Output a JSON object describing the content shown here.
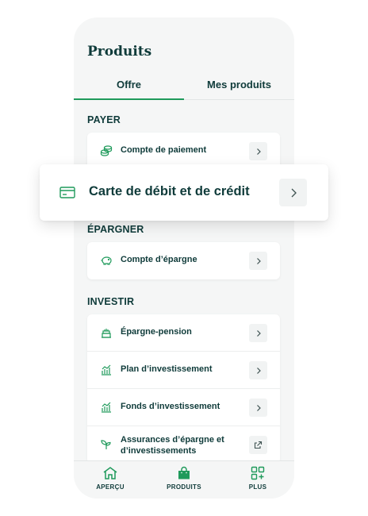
{
  "page": {
    "title": "Produits",
    "tabs": [
      {
        "label": "Offre",
        "active": true
      },
      {
        "label": "Mes produits",
        "active": false
      }
    ]
  },
  "sections": {
    "payer": {
      "heading": "PAYER",
      "items": [
        {
          "label": "Compte de paiement",
          "icon": "coins-icon"
        }
      ]
    },
    "epargner": {
      "heading": "ÉPARGNER",
      "items": [
        {
          "label": "Compte d’épargne",
          "icon": "piggy-bank-icon"
        }
      ]
    },
    "investir": {
      "heading": "INVESTIR",
      "items": [
        {
          "label": "Épargne-pension",
          "icon": "cake-icon",
          "action": "chevron-right-icon"
        },
        {
          "label": "Plan d’investissement",
          "icon": "growth-chart-icon",
          "action": "chevron-right-icon"
        },
        {
          "label": "Fonds d’investissement",
          "icon": "growth-chart-icon",
          "action": "chevron-right-icon"
        },
        {
          "label": "Assurances d’épargne et d’investissements",
          "icon": "sprout-icon",
          "action": "external-link-icon"
        }
      ]
    }
  },
  "popup": {
    "label": "Carte de débit et de crédit",
    "icon": "credit-card-icon"
  },
  "bottom_nav": [
    {
      "label": "APERÇU",
      "icon": "home-icon"
    },
    {
      "label": "PRODUITS",
      "icon": "shopping-bag-icon",
      "active": true
    },
    {
      "label": "PLUS",
      "icon": "grid-plus-icon"
    }
  ],
  "colors": {
    "brand_green": "#1f9a5b",
    "text_dark": "#0f3b3a",
    "background": "#f5f6f6"
  }
}
